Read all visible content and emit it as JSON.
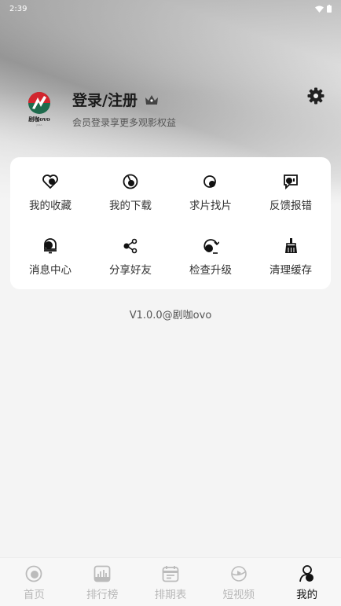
{
  "status_bar": {
    "time": "2:39"
  },
  "profile": {
    "logo_text": "剧咖ovo",
    "logo_subtext": "JUKA",
    "login_title": "登录/注册",
    "subtitle": "会员登录享更多观影权益"
  },
  "menu": [
    {
      "label": "我的收藏",
      "icon": "heart-icon"
    },
    {
      "label": "我的下载",
      "icon": "download-icon"
    },
    {
      "label": "求片找片",
      "icon": "search-movie-icon"
    },
    {
      "label": "反馈报错",
      "icon": "feedback-icon"
    },
    {
      "label": "消息中心",
      "icon": "bell-icon"
    },
    {
      "label": "分享好友",
      "icon": "share-icon"
    },
    {
      "label": "检查升级",
      "icon": "upgrade-icon"
    },
    {
      "label": "清理缓存",
      "icon": "broom-icon"
    }
  ],
  "version": "V1.0.0@剧咖ovo",
  "tabs": [
    {
      "label": "首页",
      "icon": "home-icon",
      "active": false
    },
    {
      "label": "排行榜",
      "icon": "ranking-icon",
      "active": false
    },
    {
      "label": "排期表",
      "icon": "calendar-icon",
      "active": false
    },
    {
      "label": "短视频",
      "icon": "short-video-icon",
      "active": false
    },
    {
      "label": "我的",
      "icon": "profile-icon",
      "active": true
    }
  ],
  "colors": {
    "logo_red": "#d2262e",
    "logo_green": "#1f6b4d",
    "active_tab": "#111111",
    "inactive_tab": "#b8b8b8"
  }
}
